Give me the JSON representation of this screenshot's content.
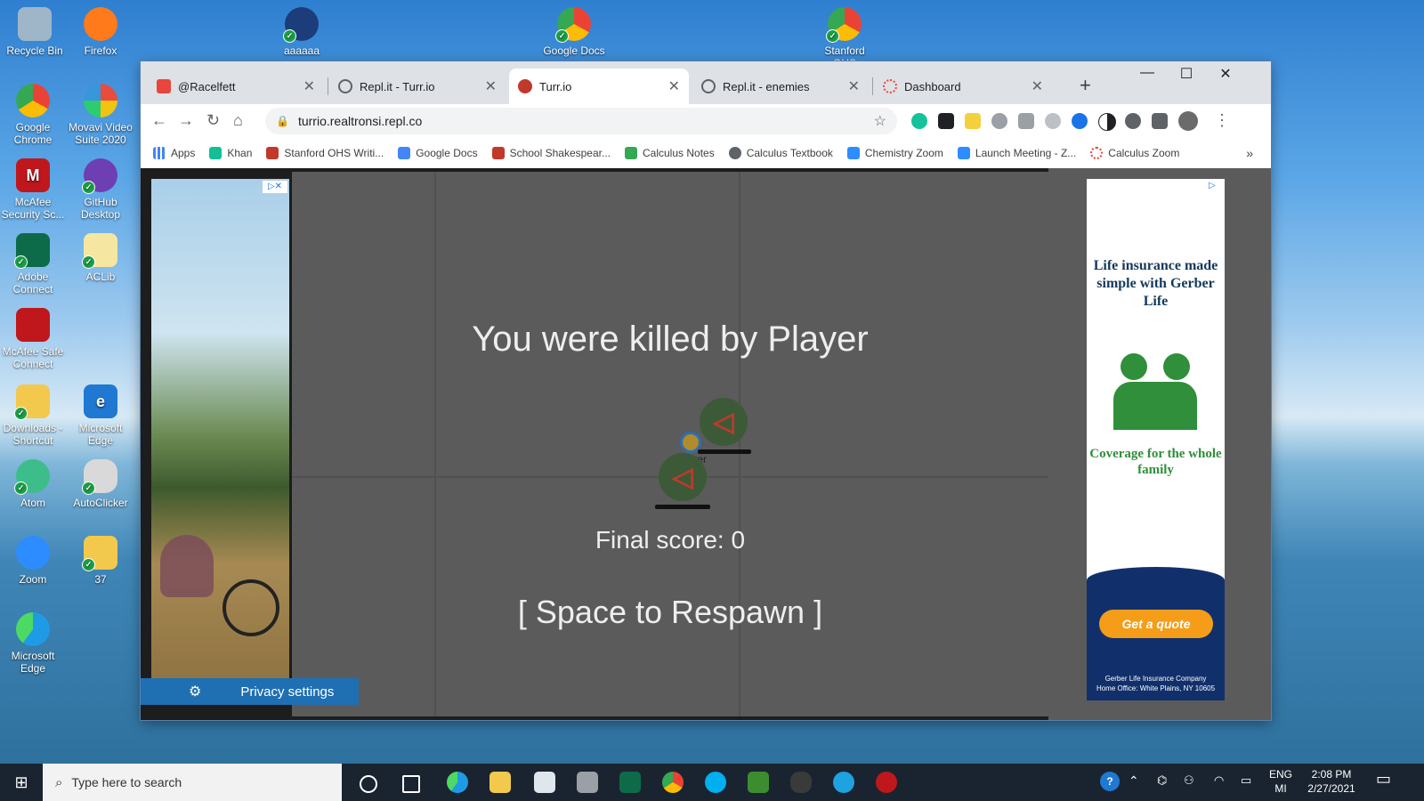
{
  "desktop": {
    "icons": [
      {
        "label": "Recycle Bin",
        "color": "#9fb6c9"
      },
      {
        "label": "Firefox",
        "color": "#ff7a1a"
      },
      {
        "label": "aaaaaa",
        "color": "#1c3d7a"
      },
      {
        "label": "Google Docs",
        "color": "#e8453c"
      },
      {
        "label": "Stanford OHS",
        "color": "#e8453c"
      },
      {
        "label": "Google Chrome",
        "color": "#e8453c"
      },
      {
        "label": "Movavi Video Suite 2020",
        "color": "#f2f2f2"
      },
      {
        "label": "McAfee Security Sc...",
        "color": "#c0171c"
      },
      {
        "label": "GitHub Desktop",
        "color": "#6e3fb3"
      },
      {
        "label": "Adobe Connect",
        "color": "#0d6b49"
      },
      {
        "label": "ACLib",
        "color": "#f5e7a1"
      },
      {
        "label": "McAfee Safe Connect",
        "color": "#c0171c"
      },
      {
        "label": "Downloads - Shortcut",
        "color": "#f2c94c"
      },
      {
        "label": "Microsoft Edge",
        "color": "#1f78d1"
      },
      {
        "label": "Atom",
        "color": "#3dbd8a"
      },
      {
        "label": "AutoClicker",
        "color": "#d9d9d9"
      },
      {
        "label": "Zoom",
        "color": "#2d8cff"
      },
      {
        "label": "37",
        "color": "#f2c94c"
      },
      {
        "label": "Microsoft Edge",
        "color": "#1f9be6"
      }
    ]
  },
  "browser": {
    "tabs": [
      {
        "title": "@Racelfett",
        "icon": "replit-user-icon"
      },
      {
        "title": "Repl.it - Turr.io",
        "icon": "replit-icon"
      },
      {
        "title": "Turr.io",
        "icon": "turrio-icon"
      },
      {
        "title": "Repl.it - enemies",
        "icon": "replit-icon"
      },
      {
        "title": "Dashboard",
        "icon": "dashboard-icon"
      }
    ],
    "url": "turrio.realtronsi.repl.co",
    "bookmarks": [
      {
        "label": "Apps",
        "color": "#5f6368"
      },
      {
        "label": "Khan",
        "color": "#14bf96"
      },
      {
        "label": "Stanford OHS Writi...",
        "color": "#c0392b"
      },
      {
        "label": "Google Docs",
        "color": "#4285f4"
      },
      {
        "label": "School Shakespear...",
        "color": "#c0392b"
      },
      {
        "label": "Calculus Notes",
        "color": "#34a853"
      },
      {
        "label": "Calculus Textbook",
        "color": "#5f6368"
      },
      {
        "label": "Chemistry Zoom",
        "color": "#2d8cff"
      },
      {
        "label": "Launch Meeting - Z...",
        "color": "#2d8cff"
      },
      {
        "label": "Calculus Zoom",
        "color": "#e8453c"
      }
    ],
    "more_bookmarks": "»"
  },
  "game": {
    "killed_message": "You were killed by Player",
    "player_label": "Player",
    "final_score": "Final score: 0",
    "respawn_prompt": "[ Space to Respawn ]"
  },
  "ads": {
    "right_headline": "Life insurance made simple with Gerber Life",
    "right_coverage": "Coverage for the whole family",
    "right_cta": "Get a quote",
    "right_fine_1": "Gerber Life Insurance Company",
    "right_fine_2": "Home Office: White Plains, NY 10605",
    "adchoices": "▷✕"
  },
  "privacy": {
    "label": "Privacy settings"
  },
  "taskbar": {
    "search_placeholder": "Type here to search",
    "lang": "ENG",
    "lang_sub": "MI",
    "time": "2:08 PM",
    "date": "2/27/2021"
  }
}
